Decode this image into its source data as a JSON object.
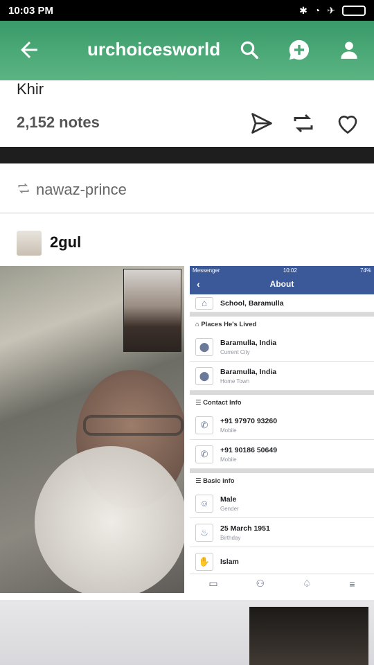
{
  "status_bar": {
    "time": "10:03 PM"
  },
  "app_bar": {
    "title": "urchoicesworld"
  },
  "post": {
    "title": "Khir",
    "notes": "2,152 notes"
  },
  "reblog": {
    "name": "nawaz-prince"
  },
  "author": {
    "name": "2gul"
  },
  "screenshot": {
    "status_left": "Messenger",
    "status_time": "10:02",
    "status_battery": "74%",
    "title": "About",
    "rows": [
      {
        "main": "School, Baramulla"
      }
    ],
    "sections": [
      {
        "header": "Places He's Lived",
        "items": [
          {
            "main": "Baramulla, India",
            "sub": "Current City"
          },
          {
            "main": "Baramulla, India",
            "sub": "Home Town"
          }
        ]
      },
      {
        "header": "Contact Info",
        "items": [
          {
            "main": "+91 97970 93260",
            "sub": "Mobile"
          },
          {
            "main": "+91 90186 50649",
            "sub": "Mobile"
          }
        ]
      },
      {
        "header": "Basic info",
        "items": [
          {
            "main": "Male",
            "sub": "Gender"
          },
          {
            "main": "25 March 1951",
            "sub": "Birthday"
          },
          {
            "main": "Islam",
            "sub": ""
          }
        ]
      }
    ]
  },
  "colors": {
    "app_bar": "#4aa976",
    "fb_blue": "#3b5998"
  }
}
